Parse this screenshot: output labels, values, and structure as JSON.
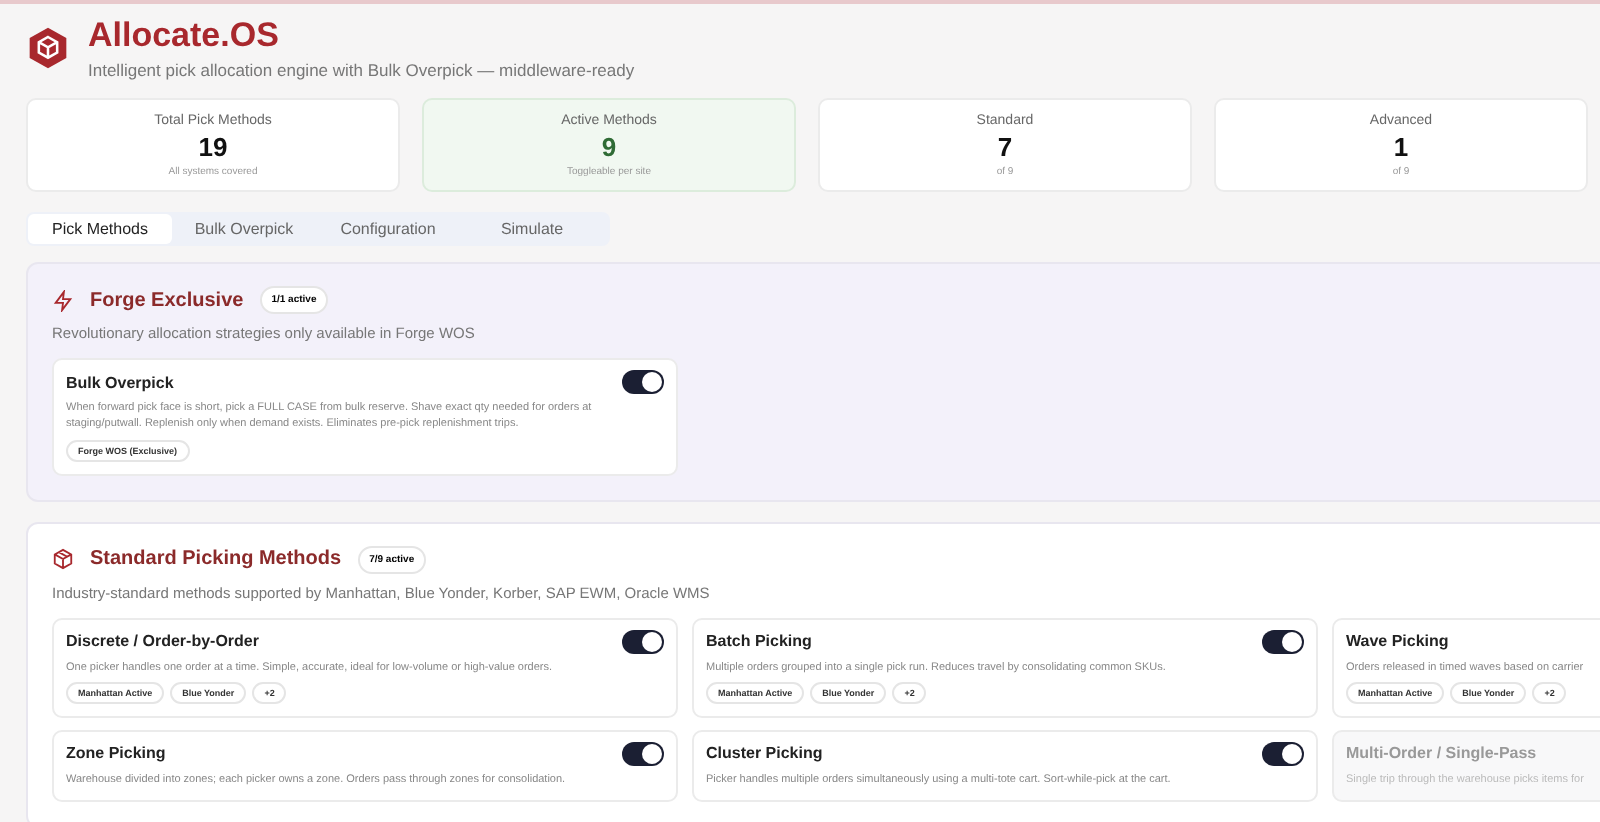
{
  "app": {
    "title": "Allocate.OS",
    "subtitle": "Intelligent pick allocation engine with Bulk Overpick — middleware-ready"
  },
  "stats": [
    {
      "label": "Total Pick Methods",
      "value": "19",
      "note": "All systems covered",
      "highlighted": false
    },
    {
      "label": "Active Methods",
      "value": "9",
      "note": "Toggleable per site",
      "highlighted": true
    },
    {
      "label": "Standard",
      "value": "7",
      "note": "of 9",
      "highlighted": false
    },
    {
      "label": "Advanced",
      "value": "1",
      "note": "of 9",
      "highlighted": false
    }
  ],
  "tabs": [
    {
      "label": "Pick Methods",
      "selected": true
    },
    {
      "label": "Bulk Overpick",
      "selected": false
    },
    {
      "label": "Configuration",
      "selected": false
    },
    {
      "label": "Simulate",
      "selected": false
    }
  ],
  "sections": [
    {
      "kind": "exclusive",
      "title": "Forge Exclusive",
      "badge": "1/1 active",
      "description": "Revolutionary allocation strategies only available in Forge WOS",
      "methods": [
        {
          "name": "Bulk Overpick",
          "description": "When forward pick face is short, pick a FULL CASE from bulk reserve. Shave exact qty needed for orders at staging/putwall. Replenish only when demand exists. Eliminates pre-pick replenishment trips.",
          "enabled": true,
          "tags": [
            "Forge WOS (Exclusive)"
          ]
        }
      ]
    },
    {
      "kind": "standard",
      "title": "Standard Picking Methods",
      "badge": "7/9 active",
      "description": "Industry-standard methods supported by Manhattan, Blue Yonder, Korber, SAP EWM, Oracle WMS",
      "methods": [
        {
          "name": "Discrete / Order-by-Order",
          "description": "One picker handles one order at a time. Simple, accurate, ideal for low-volume or high-value orders.",
          "enabled": true,
          "tags": [
            "Manhattan Active",
            "Blue Yonder",
            "+2"
          ]
        },
        {
          "name": "Batch Picking",
          "description": "Multiple orders grouped into a single pick run. Reduces travel by consolidating common SKUs.",
          "enabled": true,
          "tags": [
            "Manhattan Active",
            "Blue Yonder",
            "+2"
          ]
        },
        {
          "name": "Wave Picking",
          "description": "Orders released in timed waves based on carrier",
          "enabled": true,
          "tags": [
            "Manhattan Active",
            "Blue Yonder",
            "+2"
          ]
        },
        {
          "name": "Zone Picking",
          "description": "Warehouse divided into zones; each picker owns a zone. Orders pass through zones for consolidation.",
          "enabled": true
        },
        {
          "name": "Cluster Picking",
          "description": "Picker handles multiple orders simultaneously using a multi-tote cart. Sort-while-pick at the cart.",
          "enabled": true
        },
        {
          "name": "Multi-Order / Single-Pass",
          "description": "Single trip through the warehouse picks items for",
          "enabled": false
        }
      ]
    }
  ]
}
